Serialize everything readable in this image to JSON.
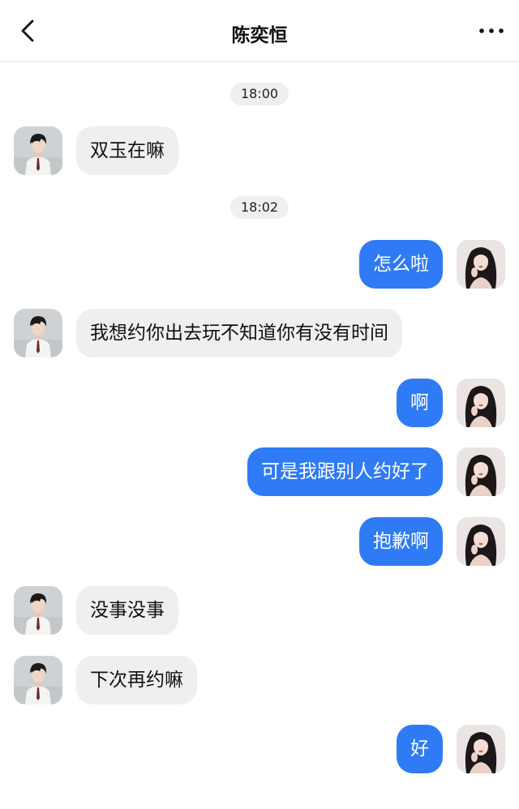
{
  "header": {
    "title": "陈奕恒",
    "back_icon": "chevron-left-icon",
    "more_icon": "more-horizontal-icon"
  },
  "timestamps": [
    "18:00",
    "18:02"
  ],
  "messages": [
    {
      "from": "contact",
      "text": "双玉在嘛"
    },
    {
      "from": "me",
      "text": "怎么啦"
    },
    {
      "from": "contact",
      "text": "我想约你出去玩不知道你有没有时间"
    },
    {
      "from": "me",
      "text": "啊"
    },
    {
      "from": "me",
      "text": "可是我跟别人约好了"
    },
    {
      "from": "me",
      "text": "抱歉啊"
    },
    {
      "from": "contact",
      "text": "没事没事"
    },
    {
      "from": "contact",
      "text": "下次再约嘛"
    },
    {
      "from": "me",
      "text": "好"
    }
  ],
  "colors": {
    "outgoing_bubble": "#2f7bf5",
    "incoming_bubble": "#efefef",
    "timestamp_pill": "#efefef"
  }
}
